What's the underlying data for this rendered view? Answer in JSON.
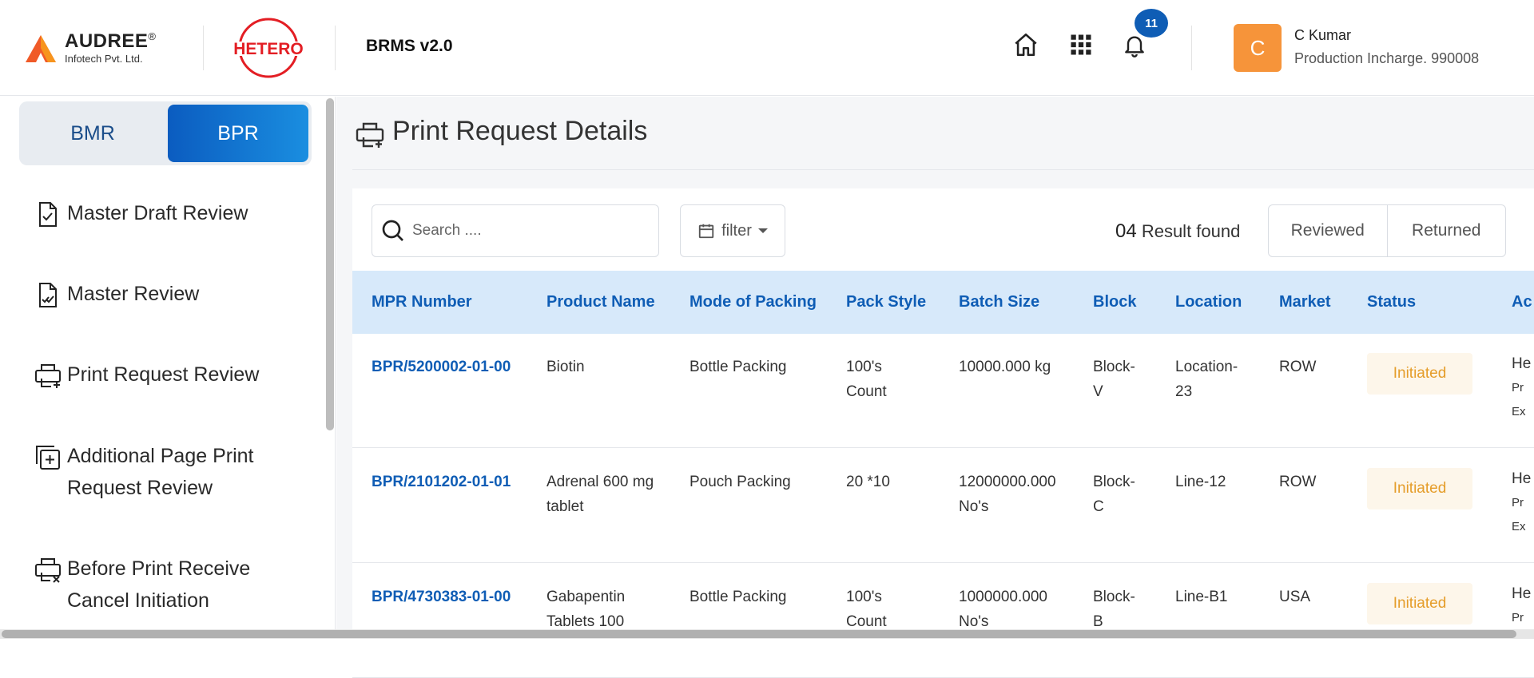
{
  "header": {
    "company": {
      "name": "AUDREE",
      "mark": "®",
      "sub": "Infotech Pvt. Ltd."
    },
    "partner_logo": "HETERO",
    "app_title": "BRMS v2.0",
    "notifications_count": "11",
    "user": {
      "initial": "C",
      "name": "C Kumar",
      "role": "Production Incharge. 990008"
    },
    "icons": [
      "home-icon",
      "apps-grid-icon",
      "bell-icon"
    ]
  },
  "sidebar": {
    "toggle": {
      "bmr": "BMR",
      "bpr": "BPR",
      "active": "BPR"
    },
    "items": [
      {
        "label": "Master Draft Review",
        "icon": "file-check-icon"
      },
      {
        "label": "Master Review",
        "icon": "file-double-check-icon"
      },
      {
        "label": "Print Request Review",
        "icon": "printer-plus-icon"
      },
      {
        "label": "Additional Page Print Request Review",
        "icon": "copy-plus-icon"
      },
      {
        "label": "Before Print Receive Cancel Initiation",
        "icon": "printer-cancel-icon"
      }
    ]
  },
  "main": {
    "title": "Print Request Details",
    "search_placeholder": "Search ....",
    "filter_label": "filter",
    "result_count": "04",
    "result_text": "Result found",
    "segments": [
      "Reviewed",
      "Returned"
    ],
    "columns": [
      "MPR Number",
      "Product Name",
      "Mode of Packing",
      "Pack Style",
      "Batch Size",
      "Block",
      "Location",
      "Market",
      "Status",
      "Ac"
    ],
    "rows": [
      {
        "mpr": "BPR/5200002-01-00",
        "product": "Biotin",
        "packing": "Bottle Packing",
        "pack_style": "100's Count",
        "batch": "10000.000 kg",
        "block": "Block-V",
        "location": "Location-23",
        "market": "ROW",
        "status": "Initiated",
        "action": [
          "He",
          "Pr",
          "Ex"
        ]
      },
      {
        "mpr": "BPR/2101202-01-01",
        "product": "Adrenal 600 mg tablet",
        "packing": "Pouch Packing",
        "pack_style": "20 *10",
        "batch": "12000000.000 No's",
        "block": "Block-C",
        "location": "Line-12",
        "market": "ROW",
        "status": "Initiated",
        "action": [
          "He",
          "Pr",
          "Ex"
        ]
      },
      {
        "mpr": "BPR/4730383-01-00",
        "product": "Gabapentin Tablets 100",
        "packing": "Bottle Packing",
        "pack_style": "100's Count",
        "batch": "1000000.000 No's",
        "block": "Block-B",
        "location": "Line-B1",
        "market": "USA",
        "status": "Initiated",
        "action": [
          "He",
          "Pr"
        ]
      }
    ]
  },
  "colors": {
    "primary": "#0f5db5",
    "accent": "#f6943a",
    "status_initiated": "#e59d2a",
    "header_row": "#d7e9fa"
  }
}
